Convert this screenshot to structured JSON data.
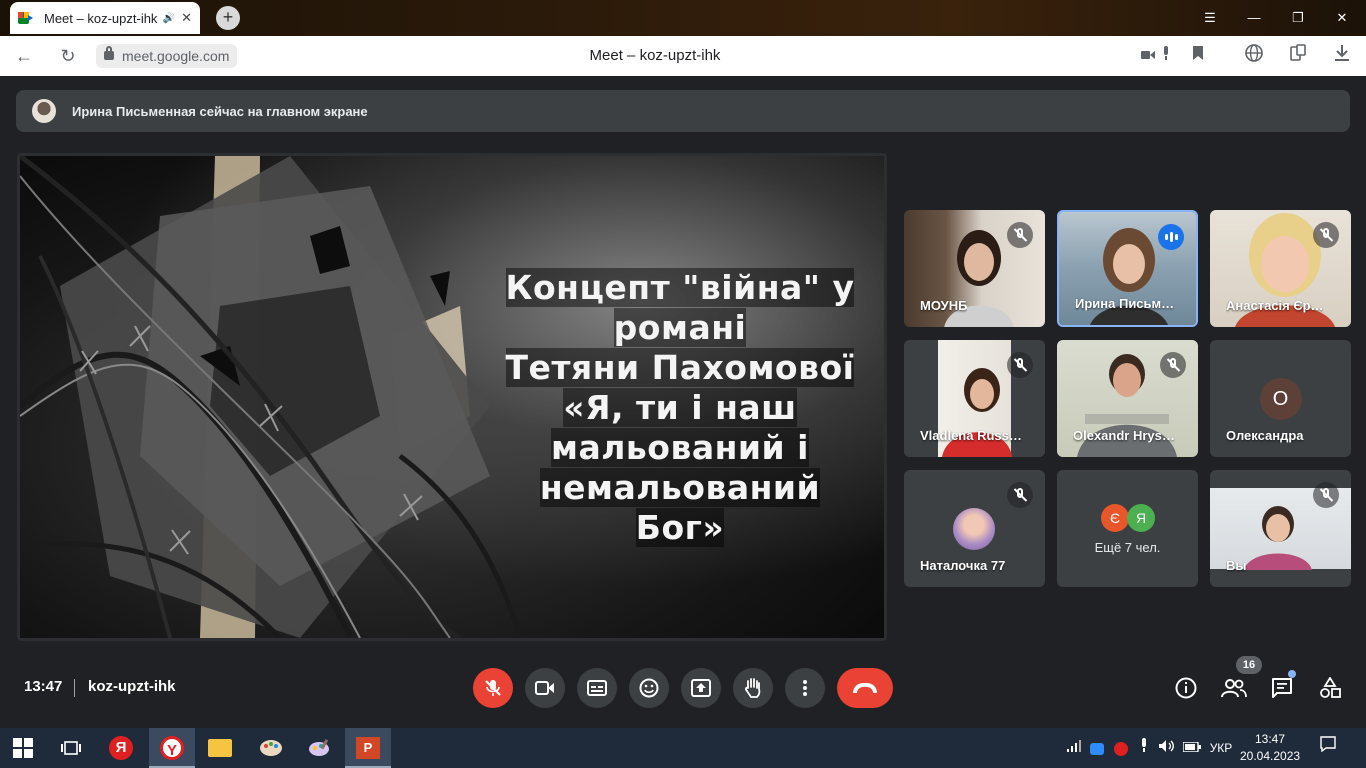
{
  "browser": {
    "tab_title": "Meet – koz-upzt-ihk",
    "tab_speaker": "🔊",
    "tab_close": "✕",
    "new_tab": "+",
    "win_menu": "☰",
    "win_min": "—",
    "win_restore": "❐",
    "win_close": "✕",
    "back": "←",
    "reload": "↻",
    "url": "meet.google.com",
    "page_title": "Meet – koz-upzt-ihk"
  },
  "meet": {
    "banner_text": "Ирина Письменная сейчас на главном экране",
    "slide_title": "Концепт \"війна\" у романі\nТетяни Пахомової «Я, ти і наш мальований і немальований Бог»",
    "participants": [
      {
        "name": "МОУНБ"
      },
      {
        "name": "Ирина Письм…"
      },
      {
        "name": "Анастасія Єр…"
      },
      {
        "name": "Vladlena Russ…"
      },
      {
        "name": "Olexandr Hrys…"
      },
      {
        "name": "Олександра",
        "initial": "О"
      },
      {
        "name": "Наталочка 77"
      },
      {
        "name": "Ещё 7 чел.",
        "initials": [
          "Є",
          "Я"
        ]
      },
      {
        "name": "Вы"
      }
    ],
    "time": "13:47",
    "meeting_code": "koz-upzt-ihk",
    "people_count": "16"
  },
  "taskbar": {
    "lang": "УКР",
    "time": "13:47",
    "date": "20.04.2023",
    "yandex_letter": "Я",
    "ppt_letter": "P"
  },
  "colors": {
    "meet_bg": "#202124",
    "tile_bg": "#3c4043",
    "end_call": "#ea4335",
    "active_border": "#8ab4f8"
  }
}
